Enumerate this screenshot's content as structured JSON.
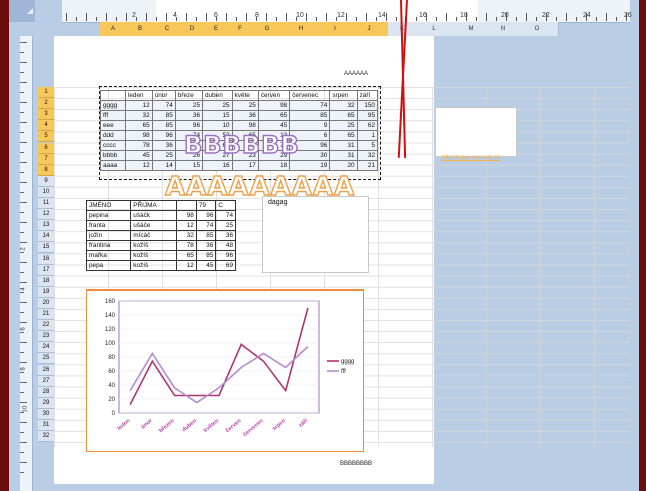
{
  "header_text": "AAAAAA",
  "footer_text": "BBBBBBBB",
  "wordart_b": "BBBBBB",
  "wordart_a": "AAAAAAAAA",
  "link_text": "http://www.seznam.cz",
  "label_dagag": "dagag",
  "ruler_numbers": [
    "2",
    "4",
    "6",
    "8",
    "10",
    "12",
    "14",
    "16",
    "18",
    "20",
    "22",
    "24",
    "26"
  ],
  "vruler_numbers": [
    "2",
    "4",
    "6",
    "8",
    "10"
  ],
  "columns": [
    "A",
    "B",
    "C",
    "D",
    "E",
    "F",
    "G",
    "H",
    "I",
    "J",
    "K",
    "L",
    "M",
    "N",
    "O"
  ],
  "rows": [
    "1",
    "2",
    "3",
    "4",
    "5",
    "6",
    "7",
    "8",
    "9",
    "10",
    "11",
    "12",
    "13",
    "14",
    "15",
    "16",
    "17",
    "18",
    "19",
    "20",
    "21",
    "22",
    "23",
    "24",
    "25",
    "26",
    "27",
    "28",
    "29",
    "30",
    "31",
    "32"
  ],
  "table1": {
    "headers": [
      "",
      "leden",
      "únor",
      "březe",
      "duben",
      "květe",
      "červen",
      "červenec",
      "srpen",
      "září"
    ],
    "rows": [
      {
        "name": "gggg",
        "values": [
          "12",
          "74",
          "25",
          "25",
          "25",
          "98",
          "74",
          "32",
          "150"
        ]
      },
      {
        "name": "fff",
        "values": [
          "32",
          "85",
          "36",
          "15",
          "36",
          "65",
          "85",
          "65",
          "95"
        ]
      },
      {
        "name": "eee",
        "values": [
          "65",
          "85",
          "96",
          "10",
          "98",
          "45",
          "9",
          "25",
          "62"
        ]
      },
      {
        "name": "ddd",
        "values": [
          "98",
          "96",
          "74",
          "52",
          "65",
          "12",
          "6",
          "65",
          "1"
        ]
      },
      {
        "name": "cccc",
        "values": [
          "78",
          "36",
          "45",
          "60",
          "41",
          "74",
          "96",
          "31",
          "5"
        ]
      },
      {
        "name": "bbbb",
        "values": [
          "45",
          "25",
          "26",
          "27",
          "23",
          "29",
          "30",
          "31",
          "32"
        ]
      },
      {
        "name": "aaaa",
        "values": [
          "12",
          "14",
          "15",
          "16",
          "17",
          "18",
          "19",
          "20",
          "21"
        ]
      }
    ]
  },
  "table2": {
    "headers": [
      "JMÉNO",
      "PŘIJMA",
      "79",
      "C"
    ],
    "rows": [
      {
        "jmeno": "pepina",
        "prijmeni": "ušáčk",
        "a": "98",
        "b": "96",
        "c": "74"
      },
      {
        "jmeno": "franta",
        "prijmeni": "ušáče",
        "a": "12",
        "b": "74",
        "c": "25"
      },
      {
        "jmeno": "jožin",
        "prijmeni": "mícáč",
        "a": "32",
        "b": "85",
        "c": "36"
      },
      {
        "jmeno": "frantina",
        "prijmeni": "kožíš",
        "a": "78",
        "b": "36",
        "c": "48"
      },
      {
        "jmeno": "mařka",
        "prijmeni": "kožíš",
        "a": "65",
        "b": "85",
        "c": "96"
      },
      {
        "jmeno": "pepa",
        "prijmeni": "kožíš",
        "a": "12",
        "b": "45",
        "c": "69"
      }
    ]
  },
  "chart_data": {
    "type": "line",
    "categories": [
      "leden",
      "únor",
      "březen",
      "duben",
      "květen",
      "červen",
      "červenec",
      "srpen",
      "září"
    ],
    "series": [
      {
        "name": "gggg",
        "color": "#b0356f",
        "values": [
          12,
          74,
          25,
          25,
          25,
          98,
          74,
          32,
          150
        ]
      },
      {
        "name": "fff",
        "color": "#b58ad0",
        "values": [
          32,
          85,
          36,
          15,
          36,
          65,
          85,
          65,
          95
        ]
      }
    ],
    "yticks": [
      "160",
      "140",
      "120",
      "100",
      "80",
      "60",
      "40",
      "20",
      "0"
    ],
    "ylim": [
      0,
      160
    ],
    "legend": "right"
  }
}
